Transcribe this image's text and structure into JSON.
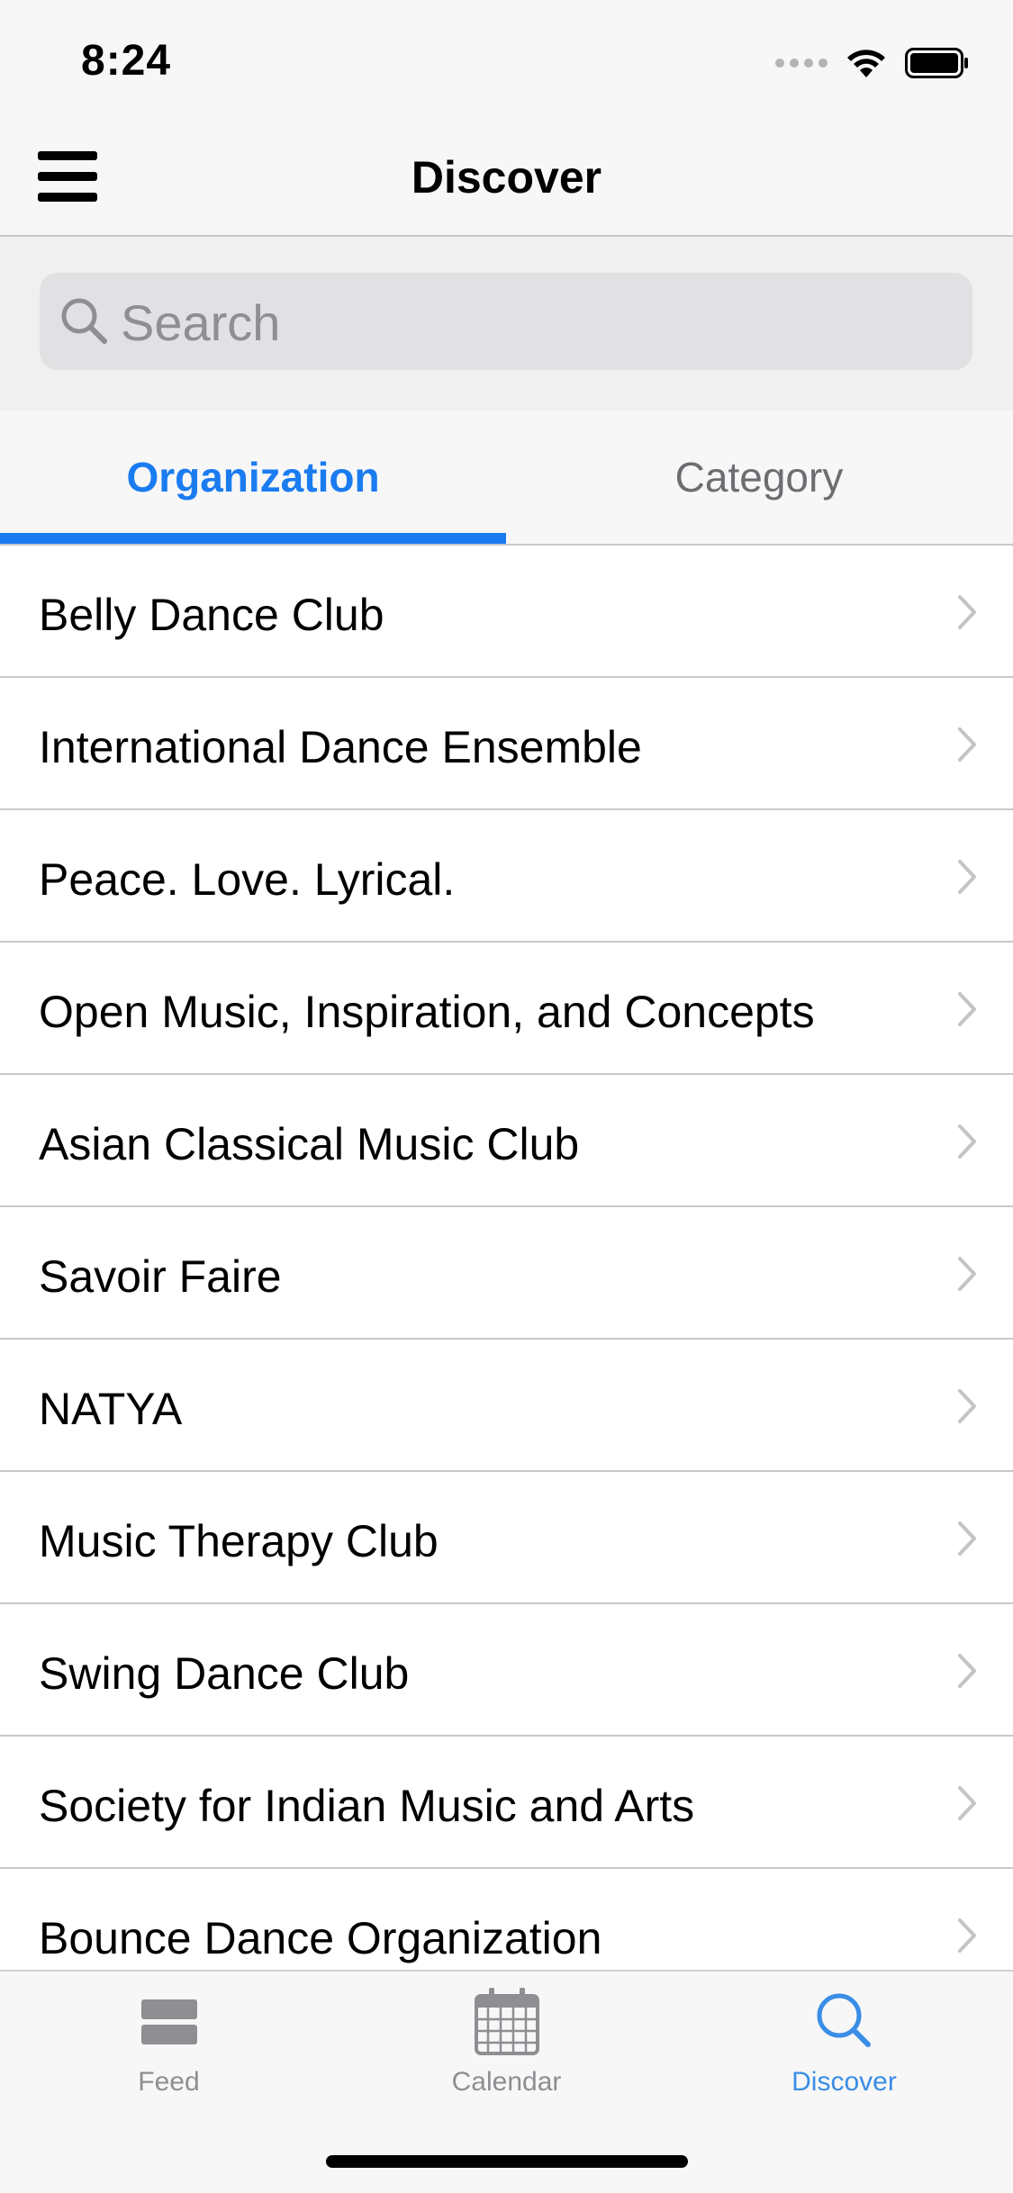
{
  "status_bar": {
    "time": "8:24",
    "icons": [
      "signal-icon",
      "wifi-icon",
      "battery-icon"
    ]
  },
  "nav": {
    "title": "Discover",
    "menu_icon": "hamburger-menu-icon"
  },
  "search": {
    "placeholder": "Search",
    "value": "",
    "icon": "search-icon"
  },
  "segments": [
    {
      "label": "Organization",
      "active": true
    },
    {
      "label": "Category",
      "active": false
    }
  ],
  "list": {
    "items": [
      {
        "label": "Belly Dance Club"
      },
      {
        "label": "International Dance Ensemble"
      },
      {
        "label": "Peace. Love. Lyrical."
      },
      {
        "label": "Open Music, Inspiration, and Concepts"
      },
      {
        "label": "Asian Classical Music Club"
      },
      {
        "label": "Savoir Faire"
      },
      {
        "label": "NATYA"
      },
      {
        "label": "Music Therapy Club"
      },
      {
        "label": "Swing Dance Club"
      },
      {
        "label": "Society for Indian Music and Arts"
      },
      {
        "label": "Bounce Dance Organization"
      }
    ]
  },
  "tab_bar": {
    "tabs": [
      {
        "label": "Feed",
        "icon": "feed-icon",
        "active": false
      },
      {
        "label": "Calendar",
        "icon": "calendar-icon",
        "active": false
      },
      {
        "label": "Discover",
        "icon": "search-icon",
        "active": true
      }
    ]
  },
  "colors": {
    "accent": "#1a7cf0",
    "tab_active": "#3a8de6",
    "tab_inactive": "#8e8e93",
    "separator": "#c8c8c8"
  }
}
